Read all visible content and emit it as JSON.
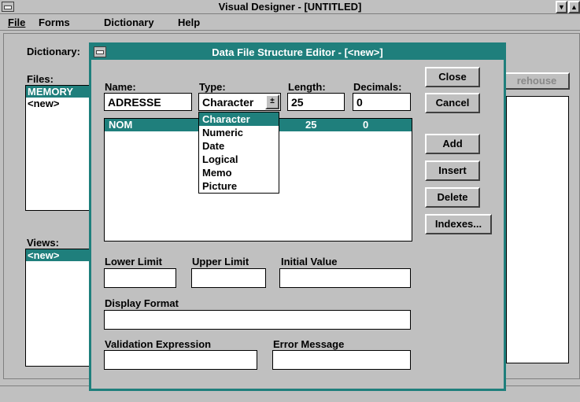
{
  "main_window": {
    "title": "Visual Designer - [UNTITLED]",
    "menu": [
      "File",
      "Forms",
      "Dictionary",
      "Help"
    ],
    "dictionary_label": "Dictionary:",
    "files_label": "Files:",
    "files": [
      "MEMORY",
      "<new>"
    ],
    "views_label": "Views:",
    "views": [
      "<new>"
    ],
    "warehouse_button": "rehouse"
  },
  "dialog": {
    "title": "Data File Structure Editor - [<new>]",
    "name_label": "Name:",
    "name_value": "ADRESSE",
    "type_label": "Type:",
    "type_value": "Character",
    "length_label": "Length:",
    "length_value": "25",
    "decimals_label": "Decimals:",
    "decimals_value": "0",
    "type_options": [
      "Character",
      "Numeric",
      "Date",
      "Logical",
      "Memo",
      "Picture"
    ],
    "fields": [
      {
        "name": "NOM",
        "length": "25",
        "decimals": "0"
      }
    ],
    "buttons": {
      "close": "Close",
      "cancel": "Cancel",
      "add": "Add",
      "insert": "Insert",
      "delete": "Delete",
      "indexes": "Indexes..."
    },
    "lower_limit_label": "Lower Limit",
    "upper_limit_label": "Upper Limit",
    "initial_value_label": "Initial Value",
    "display_format_label": "Display Format",
    "validation_label": "Validation Expression",
    "error_message_label": "Error Message"
  },
  "colors": {
    "title_bar": "#1f7f7c",
    "selection": "#1f7f7c",
    "face": "#c0c0c0"
  }
}
